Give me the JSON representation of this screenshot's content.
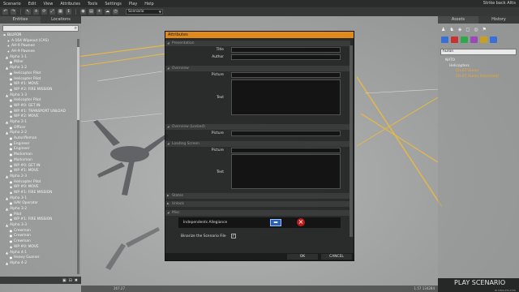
{
  "menubar": {
    "items": [
      "Scenario",
      "Edit",
      "View",
      "Attributes",
      "Tools",
      "Settings",
      "Play",
      "Help"
    ],
    "window_title": "Strike back Altis"
  },
  "toolbar": {
    "mode_select": "Scenario",
    "icons": [
      "undo-icon",
      "redo-icon",
      "select-icon",
      "move-icon",
      "rotate-icon",
      "scale-icon",
      "grid-icon",
      "vertical-icon",
      "camera-icon",
      "map-icon",
      "light-icon",
      "weather-icon",
      "time-icon"
    ]
  },
  "left_panel": {
    "tabs": [
      "Entities",
      "Locations"
    ],
    "tree": [
      {
        "label": "BLUFOR",
        "icon": "flag",
        "group": true
      },
      {
        "label": "A-164 Wipeout (CAS)",
        "icon": "plane"
      },
      {
        "label": "AH-9 Pawnee",
        "icon": "heli"
      },
      {
        "label": "AH-9 Pawnee",
        "icon": "heli"
      },
      {
        "label": "Alpha 1-1",
        "icon": "group"
      },
      {
        "label": "Miller",
        "icon": "unit"
      },
      {
        "label": "Alpha 1-2",
        "icon": "group"
      },
      {
        "label": "Helicopter Pilot",
        "icon": "unit"
      },
      {
        "label": "Helicopter Pilot",
        "icon": "unit"
      },
      {
        "label": "WP #1: MOVE",
        "icon": "wp"
      },
      {
        "label": "WP #2: FIRE MISSION",
        "icon": "wp"
      },
      {
        "label": "Alpha 1-3",
        "icon": "group"
      },
      {
        "label": "Helicopter Pilot",
        "icon": "unit"
      },
      {
        "label": "WP #0: GET IN",
        "icon": "wp"
      },
      {
        "label": "WP #1: TRANSPORT UNLOAD",
        "icon": "wp"
      },
      {
        "label": "WP #2: MOVE",
        "icon": "wp"
      },
      {
        "label": "Alpha 2-1",
        "icon": "group"
      },
      {
        "label": "Officer",
        "icon": "unit"
      },
      {
        "label": "Alpha 2-2",
        "icon": "group"
      },
      {
        "label": "Autorifleman",
        "icon": "unit"
      },
      {
        "label": "Engineer",
        "icon": "unit"
      },
      {
        "label": "Engineer",
        "icon": "unit"
      },
      {
        "label": "Marksman",
        "icon": "unit"
      },
      {
        "label": "Marksman",
        "icon": "unit"
      },
      {
        "label": "WP #0: GET IN",
        "icon": "wp"
      },
      {
        "label": "WP #1: MOVE",
        "icon": "wp"
      },
      {
        "label": "Alpha 2-3",
        "icon": "group"
      },
      {
        "label": "Helicopter Pilot",
        "icon": "unit"
      },
      {
        "label": "WP #0: MOVE",
        "icon": "wp"
      },
      {
        "label": "WP #1: FIRE MISSION",
        "icon": "wp"
      },
      {
        "label": "Alpha 3-1",
        "icon": "group"
      },
      {
        "label": "UAV Operator",
        "icon": "unit"
      },
      {
        "label": "Alpha 3-2",
        "icon": "group"
      },
      {
        "label": "Pilot",
        "icon": "unit"
      },
      {
        "label": "WP #1: FIRE MISSION",
        "icon": "wp"
      },
      {
        "label": "Alpha 3-3",
        "icon": "group"
      },
      {
        "label": "Crewman",
        "icon": "unit"
      },
      {
        "label": "Crewman",
        "icon": "unit"
      },
      {
        "label": "Crewman",
        "icon": "unit"
      },
      {
        "label": "WP #0: MOVE",
        "icon": "wp"
      },
      {
        "label": "Alpha 4-1",
        "icon": "group"
      },
      {
        "label": "Heavy Gunner",
        "icon": "unit"
      },
      {
        "label": "Alpha 4-2",
        "icon": "group"
      }
    ]
  },
  "right_panel": {
    "tabs": [
      "Assets",
      "History"
    ],
    "search_value": "huron",
    "tree": [
      {
        "label": "NATO",
        "level": 1
      },
      {
        "label": "Helicopters",
        "level": 2
      },
      {
        "label": "CH-67 Huron",
        "level": 3,
        "highlight": true
      },
      {
        "label": "CH-67 Huron (Unarmed)",
        "level": 3,
        "highlight": true
      }
    ],
    "side_colors": [
      "#3a6fd8",
      "#c83232",
      "#2fa84a",
      "#9a4ab8",
      "#c8a020",
      "#3a6fd8"
    ],
    "play_button": "PLAY SCENARIO",
    "play_sub": "IN SINGLEPLAYER"
  },
  "statusbar": {
    "left": "267.27",
    "coords": "1.57 134284"
  },
  "dialog": {
    "title": "Attributes",
    "sections": {
      "presentation": "Presentation",
      "overview": "Overview",
      "overview_locked": "Overview (Locked)",
      "loading_screen": "Loading Screen",
      "states": "States",
      "unlock": "Unlock",
      "misc": "Misc"
    },
    "labels": {
      "title": "Title",
      "author": "Author",
      "picture": "Picture",
      "text": "Text",
      "independents_allegiance": "Independents Allegiance",
      "binarize": "Binarize the Scenario File"
    },
    "ok": "OK",
    "cancel": "CANCEL",
    "binarize_checked": true
  }
}
